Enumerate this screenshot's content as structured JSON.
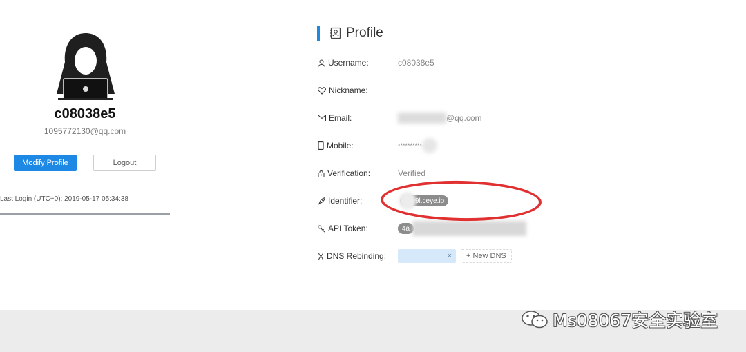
{
  "user": {
    "name": "c08038e5",
    "email": "1095772130@qq.com",
    "modify_label": "Modify Profile",
    "logout_label": "Logout",
    "last_login": "Last Login (UTC+0): 2019-05-17 05:34:38"
  },
  "profile": {
    "title": "Profile",
    "rows": [
      {
        "label": "Username:",
        "value": "c08038e5"
      },
      {
        "label": "Nickname:",
        "value": ""
      },
      {
        "label": "Email:",
        "value": "@qq.com"
      },
      {
        "label": "Mobile:",
        "value": "**********"
      },
      {
        "label": "Verification:",
        "value": "Verified"
      },
      {
        "label": "Identifier:",
        "value": "9l.ceye.io"
      },
      {
        "label": "API Token:",
        "value": "4a"
      },
      {
        "label": "DNS Rebinding:",
        "value": ""
      }
    ],
    "dns_tag_close": "×",
    "new_dns_label": "+ New DNS"
  },
  "watermark": {
    "text": "Ms08067安全实验室"
  },
  "colors": {
    "accent": "#1e88e5",
    "annotation": "#e03030"
  },
  "icons": [
    "avatar-hacker-icon",
    "profile-card-icon",
    "user-icon",
    "heart-icon",
    "mail-icon",
    "phone-icon",
    "lock-icon",
    "rocket-icon",
    "key-icon",
    "hourglass-icon",
    "wechat-icon"
  ]
}
